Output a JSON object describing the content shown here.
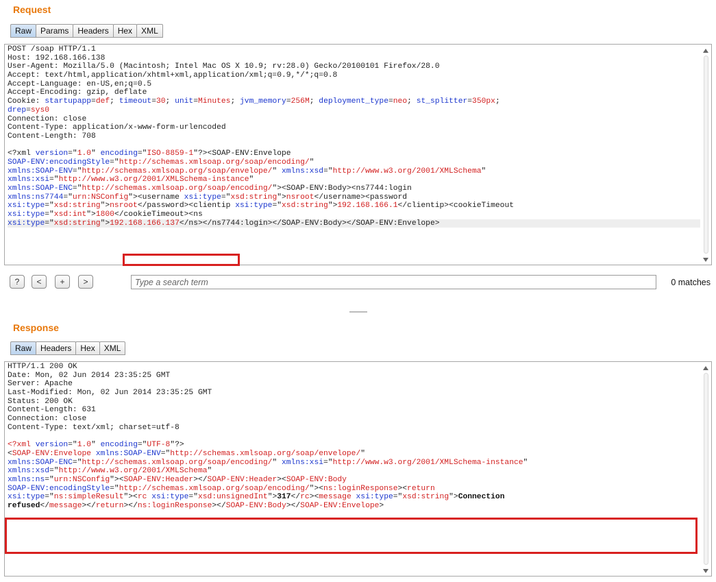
{
  "request": {
    "title": "Request",
    "tabs": [
      "Raw",
      "Params",
      "Headers",
      "Hex",
      "XML"
    ],
    "active_tab": "Raw",
    "lines": [
      [
        {
          "t": "POST /soap HTTP/1.1"
        }
      ],
      [
        {
          "t": "Host: 192.168.166.138"
        }
      ],
      [
        {
          "t": "User-Agent: Mozilla/5.0 (Macintosh; Intel Mac OS X 10.9; rv:28.0) Gecko/20100101 Firefox/28.0"
        }
      ],
      [
        {
          "t": "Accept: text/html,application/xhtml+xml,application/xml;q=0.9,*/*;q=0.8"
        }
      ],
      [
        {
          "t": "Accept-Language: en-US,en;q=0.5"
        }
      ],
      [
        {
          "t": "Accept-Encoding: gzip, deflate"
        }
      ],
      [
        {
          "t": "Cookie: "
        },
        {
          "t": "startupapp",
          "c": "attr"
        },
        {
          "t": "="
        },
        {
          "t": "def",
          "c": "val"
        },
        {
          "t": "; "
        },
        {
          "t": "timeout",
          "c": "attr"
        },
        {
          "t": "="
        },
        {
          "t": "30",
          "c": "val"
        },
        {
          "t": "; "
        },
        {
          "t": "unit",
          "c": "attr"
        },
        {
          "t": "="
        },
        {
          "t": "Minutes",
          "c": "val"
        },
        {
          "t": "; "
        },
        {
          "t": "jvm_memory",
          "c": "attr"
        },
        {
          "t": "="
        },
        {
          "t": "256M",
          "c": "val"
        },
        {
          "t": "; "
        },
        {
          "t": "deployment_type",
          "c": "attr"
        },
        {
          "t": "="
        },
        {
          "t": "neo",
          "c": "val"
        },
        {
          "t": "; "
        },
        {
          "t": "st_splitter",
          "c": "attr"
        },
        {
          "t": "="
        },
        {
          "t": "350px",
          "c": "val"
        },
        {
          "t": ";"
        }
      ],
      [
        {
          "t": "drep",
          "c": "attr"
        },
        {
          "t": "="
        },
        {
          "t": "sys0",
          "c": "val"
        }
      ],
      [
        {
          "t": "Connection: close"
        }
      ],
      [
        {
          "t": "Content-Type: application/x-www-form-urlencoded"
        }
      ],
      [
        {
          "t": "Content-Length: 708"
        }
      ],
      [
        {
          "t": " "
        }
      ],
      [
        {
          "t": "<?xml "
        },
        {
          "t": "version",
          "c": "attr"
        },
        {
          "t": "=\""
        },
        {
          "t": "1.0",
          "c": "val"
        },
        {
          "t": "\" "
        },
        {
          "t": "encoding",
          "c": "attr"
        },
        {
          "t": "=\""
        },
        {
          "t": "ISO-8859-1",
          "c": "val"
        },
        {
          "t": "\"?><SOAP-ENV:Envelope"
        }
      ],
      [
        {
          "t": "SOAP-ENV:encodingStyle",
          "c": "attr"
        },
        {
          "t": "=\""
        },
        {
          "t": "http://schemas.xmlsoap.org/soap/encoding/",
          "c": "val"
        },
        {
          "t": "\""
        }
      ],
      [
        {
          "t": "xmlns:SOAP-ENV",
          "c": "attr"
        },
        {
          "t": "=\""
        },
        {
          "t": "http://schemas.xmlsoap.org/soap/envelope/",
          "c": "val"
        },
        {
          "t": "\" "
        },
        {
          "t": "xmlns:xsd",
          "c": "attr"
        },
        {
          "t": "=\""
        },
        {
          "t": "http://www.w3.org/2001/XMLSchema",
          "c": "val"
        },
        {
          "t": "\""
        }
      ],
      [
        {
          "t": "xmlns:xsi",
          "c": "attr"
        },
        {
          "t": "=\""
        },
        {
          "t": "http://www.w3.org/2001/XMLSchema-instance",
          "c": "val"
        },
        {
          "t": "\""
        }
      ],
      [
        {
          "t": "xmlns:SOAP-ENC",
          "c": "attr"
        },
        {
          "t": "=\""
        },
        {
          "t": "http://schemas.xmlsoap.org/soap/encoding/",
          "c": "val"
        },
        {
          "t": "\"><SOAP-ENV:Body><ns7744:login"
        }
      ],
      [
        {
          "t": "xmlns:ns7744",
          "c": "attr"
        },
        {
          "t": "=\""
        },
        {
          "t": "urn:NSConfig",
          "c": "val"
        },
        {
          "t": "\"><username "
        },
        {
          "t": "xsi:type",
          "c": "attr"
        },
        {
          "t": "=\""
        },
        {
          "t": "xsd:string",
          "c": "val"
        },
        {
          "t": "\">"
        },
        {
          "t": "nsroot",
          "c": "val"
        },
        {
          "t": "</username><password"
        }
      ],
      [
        {
          "t": "xsi:type",
          "c": "attr"
        },
        {
          "t": "=\""
        },
        {
          "t": "xsd:string",
          "c": "val"
        },
        {
          "t": "\">"
        },
        {
          "t": "nsroot",
          "c": "val"
        },
        {
          "t": "</password><clientip "
        },
        {
          "t": "xsi:type",
          "c": "attr"
        },
        {
          "t": "=\""
        },
        {
          "t": "xsd:string",
          "c": "val"
        },
        {
          "t": "\">"
        },
        {
          "t": "192.168.166.1",
          "c": "val"
        },
        {
          "t": "</clientip><cookieTimeout"
        }
      ],
      [
        {
          "t": "xsi:type",
          "c": "attr"
        },
        {
          "t": "=\""
        },
        {
          "t": "xsd:int",
          "c": "val"
        },
        {
          "t": "\">"
        },
        {
          "t": "1800",
          "c": "val"
        },
        {
          "t": "</cookieTimeout><ns"
        }
      ],
      [
        {
          "t": "xsi:type",
          "c": "attr"
        },
        {
          "t": "=\""
        },
        {
          "t": "xsd:string",
          "c": "val"
        },
        {
          "t": "\">"
        },
        {
          "t": "192.168.166.137",
          "c": "val"
        },
        {
          "t": "</ns></ns7744:login></SOAP-ENV:Body></SOAP-ENV:Envelope>"
        }
      ]
    ],
    "highlighted_line": 20
  },
  "search": {
    "help_label": "?",
    "prev_label": "<",
    "add_label": "+",
    "next_label": ">",
    "placeholder": "Type a search term",
    "matches": "0 matches"
  },
  "response": {
    "title": "Response",
    "tabs": [
      "Raw",
      "Headers",
      "Hex",
      "XML"
    ],
    "active_tab": "Raw",
    "lines": [
      [
        {
          "t": "HTTP/1.1 200 OK"
        }
      ],
      [
        {
          "t": "Date: Mon, 02 Jun 2014 23:35:25 GMT"
        }
      ],
      [
        {
          "t": "Server: Apache"
        }
      ],
      [
        {
          "t": "Last-Modified: Mon, 02 Jun 2014 23:35:25 GMT"
        }
      ],
      [
        {
          "t": "Status: 200 OK"
        }
      ],
      [
        {
          "t": "Content-Length: 631"
        }
      ],
      [
        {
          "t": "Connection: close"
        }
      ],
      [
        {
          "t": "Content-Type: text/xml; charset=utf-8"
        }
      ],
      [
        {
          "t": " "
        }
      ],
      [
        {
          "t": "<?xml ",
          "c": "tagc"
        },
        {
          "t": "version",
          "c": "attr"
        },
        {
          "t": "=\""
        },
        {
          "t": "1.0",
          "c": "val"
        },
        {
          "t": "\" "
        },
        {
          "t": "encoding",
          "c": "attr"
        },
        {
          "t": "=\""
        },
        {
          "t": "UTF-8",
          "c": "val"
        },
        {
          "t": "\"?>"
        }
      ],
      [
        {
          "t": "<"
        },
        {
          "t": "SOAP-ENV:Envelope",
          "c": "tagc"
        },
        {
          "t": " "
        },
        {
          "t": "xmlns:SOAP-ENV",
          "c": "attr"
        },
        {
          "t": "=\""
        },
        {
          "t": "http://schemas.xmlsoap.org/soap/envelope/",
          "c": "val"
        },
        {
          "t": "\""
        }
      ],
      [
        {
          "t": "xmlns:SOAP-ENC",
          "c": "attr"
        },
        {
          "t": "=\""
        },
        {
          "t": "http://schemas.xmlsoap.org/soap/encoding/",
          "c": "val"
        },
        {
          "t": "\" "
        },
        {
          "t": "xmlns:xsi",
          "c": "attr"
        },
        {
          "t": "=\""
        },
        {
          "t": "http://www.w3.org/2001/XMLSchema-instance",
          "c": "val"
        },
        {
          "t": "\""
        }
      ],
      [
        {
          "t": "xmlns:xsd",
          "c": "attr"
        },
        {
          "t": "=\""
        },
        {
          "t": "http://www.w3.org/2001/XMLSchema",
          "c": "val"
        },
        {
          "t": "\""
        }
      ],
      [
        {
          "t": "xmlns:ns",
          "c": "attr"
        },
        {
          "t": "=\""
        },
        {
          "t": "urn:NSConfig",
          "c": "val"
        },
        {
          "t": "\"><"
        },
        {
          "t": "SOAP-ENV:Header",
          "c": "tagc"
        },
        {
          "t": "></"
        },
        {
          "t": "SOAP-ENV:Header",
          "c": "tagc"
        },
        {
          "t": "><"
        },
        {
          "t": "SOAP-ENV:Body",
          "c": "tagc"
        }
      ],
      [
        {
          "t": "SOAP-ENV:encodingStyle",
          "c": "attr"
        },
        {
          "t": "=\""
        },
        {
          "t": "http://schemas.xmlsoap.org/soap/encoding/",
          "c": "val"
        },
        {
          "t": "\"><"
        },
        {
          "t": "ns:loginResponse",
          "c": "tagc"
        },
        {
          "t": "><"
        },
        {
          "t": "return",
          "c": "tagc"
        }
      ],
      [
        {
          "t": "xsi:type",
          "c": "attr"
        },
        {
          "t": "=\""
        },
        {
          "t": "ns:simpleResult",
          "c": "val"
        },
        {
          "t": "\"><"
        },
        {
          "t": "rc",
          "c": "tagc"
        },
        {
          "t": " "
        },
        {
          "t": "xsi:type",
          "c": "attr"
        },
        {
          "t": "=\""
        },
        {
          "t": "xsd:unsignedInt",
          "c": "val"
        },
        {
          "t": "\">"
        },
        {
          "t": "317",
          "c": "b"
        },
        {
          "t": "</"
        },
        {
          "t": "rc",
          "c": "tagc"
        },
        {
          "t": "><"
        },
        {
          "t": "message",
          "c": "tagc"
        },
        {
          "t": " "
        },
        {
          "t": "xsi:type",
          "c": "attr"
        },
        {
          "t": "=\""
        },
        {
          "t": "xsd:string",
          "c": "val"
        },
        {
          "t": "\">"
        },
        {
          "t": "Connection",
          "c": "b"
        }
      ],
      [
        {
          "t": "refused",
          "c": "b"
        },
        {
          "t": "</"
        },
        {
          "t": "message",
          "c": "tagc"
        },
        {
          "t": "></"
        },
        {
          "t": "return",
          "c": "tagc"
        },
        {
          "t": "></"
        },
        {
          "t": "ns:loginResponse",
          "c": "tagc"
        },
        {
          "t": "></"
        },
        {
          "t": "SOAP-ENV:Body",
          "c": "tagc"
        },
        {
          "t": "></"
        },
        {
          "t": "SOAP-ENV:Envelope",
          "c": "tagc"
        },
        {
          "t": ">"
        }
      ]
    ]
  },
  "colors": {
    "section_title": "#e8780b",
    "highlight_box": "#d8201f",
    "attr_name": "#1c37ce",
    "attr_value": "#d21f1f"
  }
}
